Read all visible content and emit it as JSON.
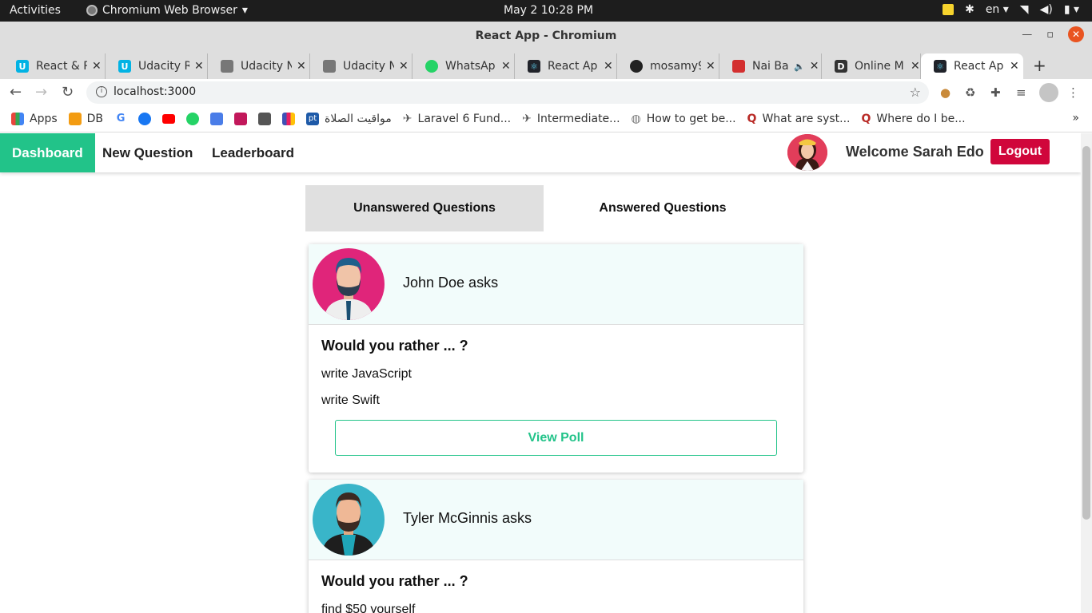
{
  "os": {
    "activities": "Activities",
    "app_menu": "Chromium Web Browser",
    "clock": "May 2  10:28 PM",
    "lang": "en"
  },
  "window": {
    "title": "React App - Chromium"
  },
  "tabs": [
    {
      "label": "React & R",
      "icon_color": "#02b3e4"
    },
    {
      "label": "Udacity R",
      "icon_color": "#02b3e4"
    },
    {
      "label": "Udacity N",
      "icon_color": "#777777"
    },
    {
      "label": "Udacity N",
      "icon_color": "#777777"
    },
    {
      "label": "WhatsAp",
      "icon_color": "#25d366"
    },
    {
      "label": "React Ap",
      "icon_color": "#20232a"
    },
    {
      "label": "mosamy9",
      "icon_color": "#222222"
    },
    {
      "label": "Nai Ba",
      "icon_color": "#d32f2f"
    },
    {
      "label": "Online M",
      "icon_color": "#333333"
    },
    {
      "label": "React Ap",
      "icon_color": "#20232a"
    }
  ],
  "address": {
    "url": "localhost:3000"
  },
  "bookmarks": [
    {
      "label": "Apps",
      "color": "#e8453c"
    },
    {
      "label": "DB",
      "color": "#f39c12"
    },
    {
      "label": "",
      "color": "#4285f4"
    },
    {
      "label": "",
      "color": "#1877f2"
    },
    {
      "label": "",
      "color": "#ff0000"
    },
    {
      "label": "",
      "color": "#25d366"
    },
    {
      "label": "",
      "color": "#4a7de8"
    },
    {
      "label": "",
      "color": "#c2185b"
    },
    {
      "label": "",
      "color": "#555555"
    },
    {
      "label": "",
      "color": "#3f51b5"
    },
    {
      "label": "مواقيت الصلاة",
      "color": "#1e5aa8"
    },
    {
      "label": "Laravel 6 Fund...",
      "color": "#555555"
    },
    {
      "label": "Intermediate...",
      "color": "#555555"
    },
    {
      "label": "How to get be...",
      "color": "#777777"
    },
    {
      "label": "What are syst...",
      "color": "#b92b27"
    },
    {
      "label": "Where do I be...",
      "color": "#b92b27"
    }
  ],
  "nav": {
    "dashboard": "Dashboard",
    "new_question": "New Question",
    "leaderboard": "Leaderboard",
    "welcome": "Welcome Sarah Edo",
    "logout": "Logout",
    "accent": "#22c389",
    "logout_color": "#d0063b"
  },
  "question_tabs": {
    "unanswered": "Unanswered Questions",
    "answered": "Answered Questions"
  },
  "questions": [
    {
      "asker": "John Doe asks",
      "prompt": "Would you rather ... ?",
      "option_one": "write JavaScript",
      "option_two": "write Swift",
      "button": "View Poll"
    },
    {
      "asker": "Tyler McGinnis asks",
      "prompt": "Would you rather ... ?",
      "option_one": "find $50 yourself"
    }
  ]
}
